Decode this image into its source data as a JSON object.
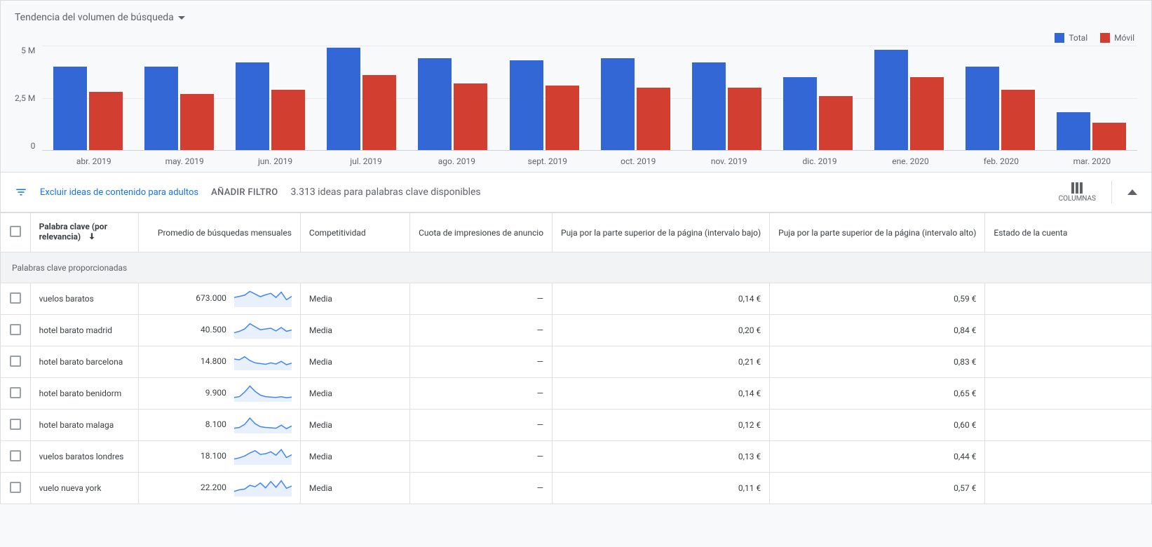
{
  "chart": {
    "title": "Tendencia del volumen de búsqueda",
    "legend": {
      "total": "Total",
      "mobile": "Móvil"
    },
    "yticks": [
      "5 M",
      "2,5 M",
      "0"
    ],
    "colors": {
      "total": "#3367d6",
      "mobile": "#d23f31"
    }
  },
  "chart_data": {
    "type": "bar",
    "categories": [
      "abr. 2019",
      "may. 2019",
      "jun. 2019",
      "jul. 2019",
      "ago. 2019",
      "sept. 2019",
      "oct. 2019",
      "nov. 2019",
      "dic. 2019",
      "ene. 2020",
      "feb. 2020",
      "mar. 2020"
    ],
    "series": [
      {
        "name": "Total",
        "values": [
          4.0,
          4.0,
          4.2,
          4.9,
          4.4,
          4.3,
          4.4,
          4.2,
          3.5,
          4.8,
          4.0,
          1.8
        ]
      },
      {
        "name": "Móvil",
        "values": [
          2.8,
          2.7,
          2.9,
          3.6,
          3.2,
          3.1,
          3.0,
          3.0,
          2.6,
          3.5,
          2.9,
          1.3
        ]
      }
    ],
    "ylabel": "",
    "xlabel": "",
    "ylim": [
      0,
      5
    ],
    "unit": "M"
  },
  "filters": {
    "exclude_adult": "Excluir ideas de contenido para adultos",
    "add_filter": "AÑADIR FILTRO",
    "summary": "3.313 ideas para palabras clave disponibles",
    "columns_label": "COLUMNAS"
  },
  "table": {
    "headers": {
      "keyword": "Palabra clave (por relevancia)",
      "avg_searches": "Promedio de búsquedas mensuales",
      "competition": "Competitividad",
      "impression_share": "Cuota de impresiones de anuncio",
      "top_bid_low": "Puja por la parte superior de la página (intervalo bajo)",
      "top_bid_high": "Puja por la parte superior de la página (intervalo alto)",
      "account_status": "Estado de la cuenta"
    },
    "group_label": "Palabras clave proporcionadas",
    "rows": [
      {
        "keyword": "vuelos baratos",
        "avg": "673.000",
        "competition": "Media",
        "impression": "—",
        "low": "0,14 €",
        "high": "0,59 €",
        "status": "",
        "spark": [
          0.55,
          0.62,
          0.7,
          0.95,
          0.78,
          0.6,
          0.72,
          0.82,
          0.55,
          0.9,
          0.4,
          0.62
        ]
      },
      {
        "keyword": "hotel barato madrid",
        "avg": "40.500",
        "competition": "Media",
        "impression": "—",
        "low": "0,20 €",
        "high": "0,84 €",
        "status": "",
        "spark": [
          0.3,
          0.4,
          0.55,
          0.9,
          0.7,
          0.5,
          0.55,
          0.6,
          0.42,
          0.65,
          0.4,
          0.48
        ]
      },
      {
        "keyword": "hotel barato barcelona",
        "avg": "14.800",
        "competition": "Media",
        "impression": "—",
        "low": "0,21 €",
        "high": "0,83 €",
        "status": "",
        "spark": [
          0.65,
          0.6,
          0.8,
          0.55,
          0.4,
          0.35,
          0.3,
          0.4,
          0.32,
          0.5,
          0.28,
          0.38
        ]
      },
      {
        "keyword": "hotel barato benidorm",
        "avg": "9.900",
        "competition": "Media",
        "impression": "—",
        "low": "0,14 €",
        "high": "0,65 €",
        "status": "",
        "spark": [
          0.2,
          0.25,
          0.55,
          0.95,
          0.6,
          0.35,
          0.25,
          0.22,
          0.2,
          0.25,
          0.18,
          0.22
        ]
      },
      {
        "keyword": "hotel barato malaga",
        "avg": "8.100",
        "competition": "Media",
        "impression": "—",
        "low": "0,12 €",
        "high": "0,60 €",
        "status": "",
        "spark": [
          0.25,
          0.3,
          0.5,
          0.92,
          0.55,
          0.35,
          0.3,
          0.28,
          0.25,
          0.45,
          0.22,
          0.4
        ]
      },
      {
        "keyword": "vuelos baratos londres",
        "avg": "18.100",
        "competition": "Media",
        "impression": "—",
        "low": "0,13 €",
        "high": "0,44 €",
        "status": "",
        "spark": [
          0.3,
          0.38,
          0.5,
          0.7,
          0.85,
          0.6,
          0.65,
          0.78,
          0.55,
          0.92,
          0.4,
          0.58
        ]
      },
      {
        "keyword": "vuelo nueva york",
        "avg": "22.200",
        "competition": "Media",
        "impression": "—",
        "low": "0,11 €",
        "high": "0,57 €",
        "status": "",
        "spark": [
          0.25,
          0.35,
          0.4,
          0.65,
          0.55,
          0.8,
          0.48,
          0.9,
          0.52,
          0.95,
          0.45,
          0.6
        ]
      }
    ]
  }
}
